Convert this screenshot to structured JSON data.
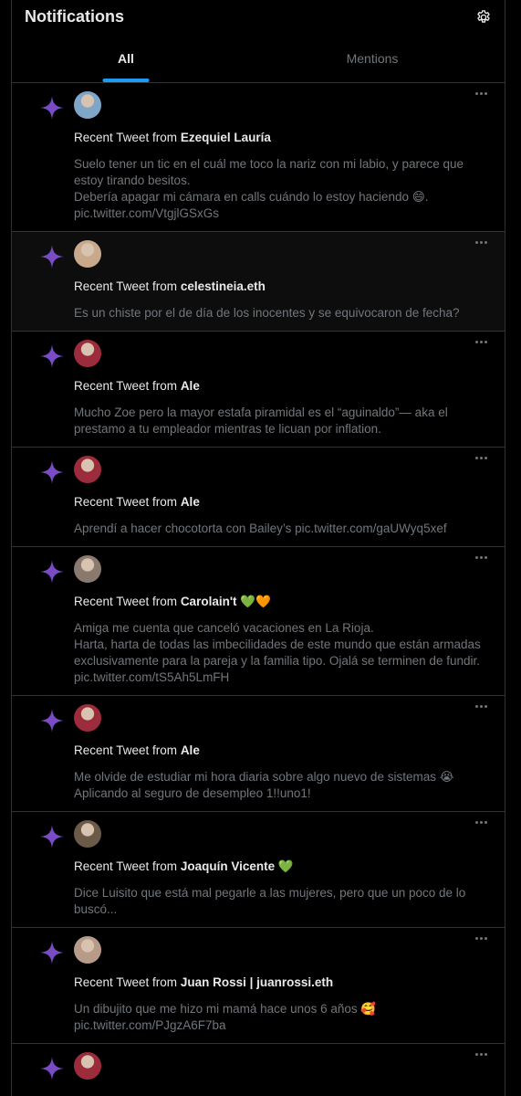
{
  "header": {
    "title": "Notifications",
    "settings_icon": "gear-icon"
  },
  "tabs": [
    {
      "label": "All",
      "active": true
    },
    {
      "label": "Mentions",
      "active": false
    }
  ],
  "notifications": [
    {
      "prefix": "Recent Tweet from ",
      "name": "Ezequiel Lauría",
      "body": "Suelo tener un tic en el cuál me toco la nariz con mi labio, y parece que estoy tirando besitos.\nDebería apagar mi cámara en calls cuándo lo estoy haciendo 😄.\npic.twitter.com/VtgjlGSxGs",
      "avatar_color": "#7fa6c9"
    },
    {
      "prefix": "Recent Tweet from ",
      "name": "celestineia.eth",
      "body": "Es un chiste por el de día de los inocentes y se equivocaron de fecha?",
      "avatar_color": "#c9a98c"
    },
    {
      "prefix": "Recent Tweet from ",
      "name": "Ale",
      "body": "Mucho Zoe pero la mayor estafa piramidal es el “aguinaldo”— aka el prestamo a tu empleador mientras te licuan por inflation.",
      "avatar_color": "#9c2b3c"
    },
    {
      "prefix": "Recent Tweet from ",
      "name": "Ale",
      "body": "Aprendí a hacer chocotorta con Bailey’s pic.twitter.com/gaUWyq5xef",
      "avatar_color": "#9c2b3c"
    },
    {
      "prefix": "Recent Tweet from ",
      "name": "Carolain't 💚🧡",
      "body": "Amiga me cuenta que canceló vacaciones en La Rioja.\nHarta, harta de todas las imbecilidades de este mundo que están armadas exclusivamente para la pareja y la familia tipo. Ojalá se terminen de fundir.\npic.twitter.com/tS5Ah5LmFH",
      "avatar_color": "#8a7a6e"
    },
    {
      "prefix": "Recent Tweet from ",
      "name": "Ale",
      "body": "Me olvide de estudiar mi hora diaria sobre algo nuevo de sistemas 😭\nAplicando al seguro de desempleo 1!!uno1!",
      "avatar_color": "#9c2b3c"
    },
    {
      "prefix": "Recent Tweet from ",
      "name": "Joaquín Vicente 💚",
      "body": "Dice Luisito que está mal pegarle a las mujeres, pero que un poco de lo buscó...",
      "avatar_color": "#6b5a48"
    },
    {
      "prefix": "Recent Tweet from ",
      "name": "Juan Rossi | juanrossi.eth",
      "body": "Un dibujito que me hizo mi mamá hace unos 6 años 🥰\npic.twitter.com/PJgzA6F7ba",
      "avatar_color": "#b89a88"
    },
    {
      "prefix": "",
      "name": "",
      "body": "",
      "avatar_color": "#9c2b3c"
    }
  ],
  "colors": {
    "accent": "#1d9bf0",
    "star": "#794bc4",
    "muted": "#71767b"
  }
}
